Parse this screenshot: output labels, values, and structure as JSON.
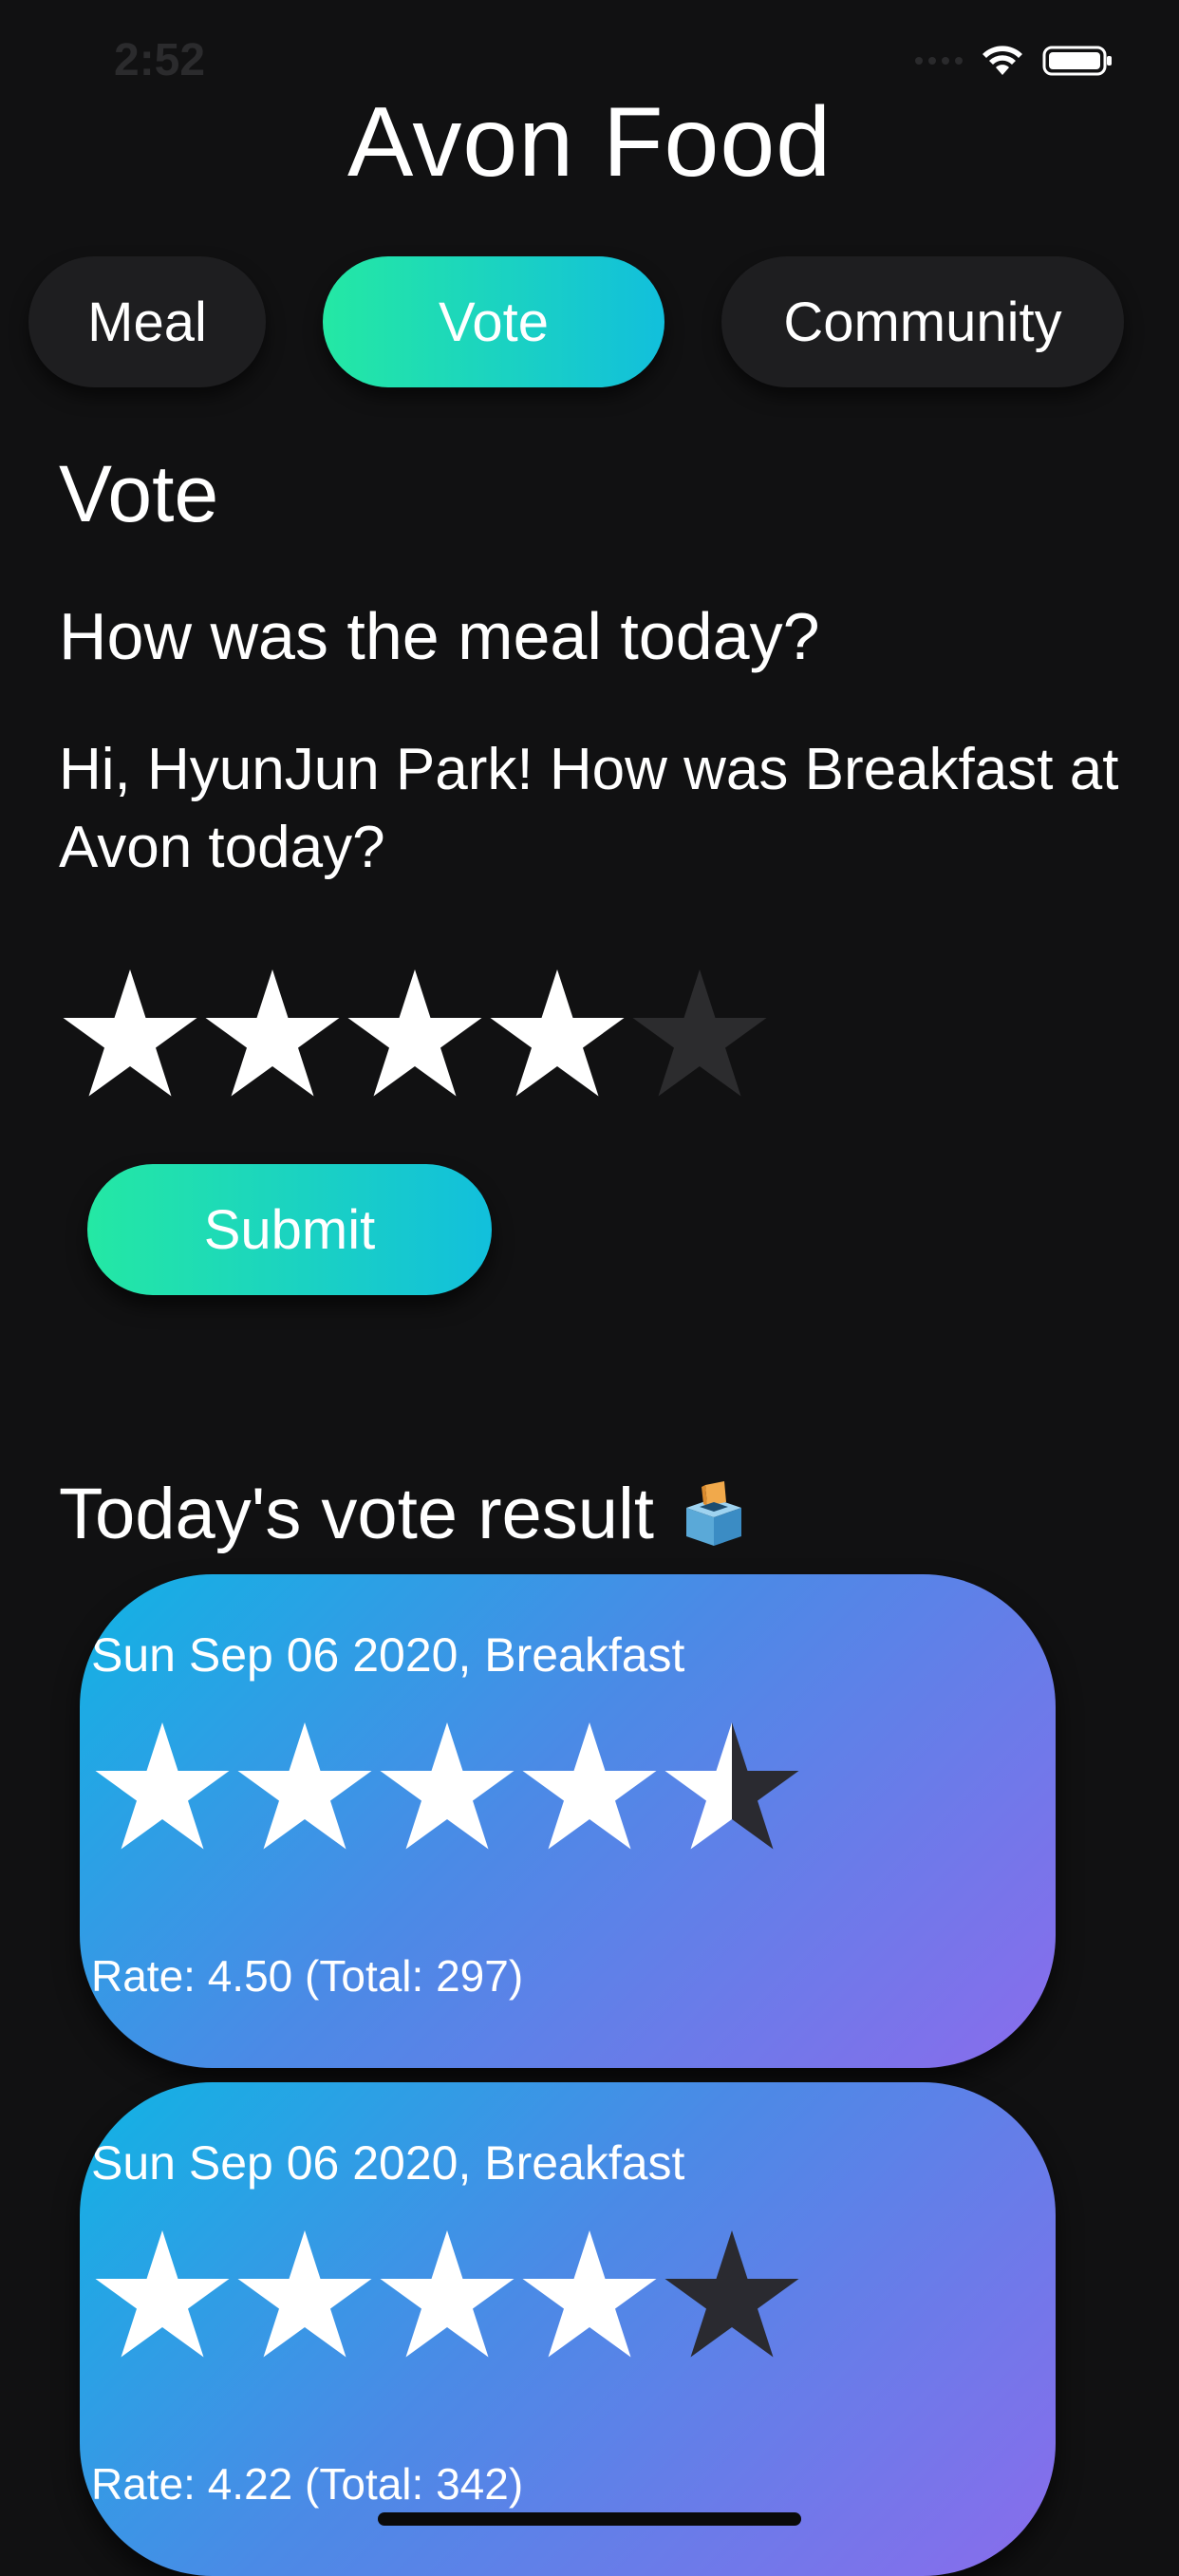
{
  "status_bar": {
    "time": "2:52",
    "icons": [
      "signal-icon",
      "wifi-icon",
      "battery-icon"
    ]
  },
  "app": {
    "title": "Avon Food"
  },
  "tabs": [
    {
      "label": "Meal",
      "active": false
    },
    {
      "label": "Vote",
      "active": true
    },
    {
      "label": "Community",
      "active": false
    }
  ],
  "vote": {
    "heading": "Vote",
    "question": "How was the meal today?",
    "greeting": "Hi, HyunJun Park! How was Breakfast at Avon today?",
    "rating_max": 5,
    "rating_value": 4,
    "submit_label": "Submit"
  },
  "results": {
    "heading": "Today's vote result",
    "heading_icon": "ballot-box-icon",
    "cards": [
      {
        "date_meal": "Sun Sep 06 2020, Breakfast",
        "rating": 4.5,
        "rate_text": "Rate: 4.50 (Total: 297)"
      },
      {
        "date_meal": "Sun Sep 06 2020, Breakfast",
        "rating": 4.22,
        "rate_text": "Rate: 4.22 (Total: 342)"
      }
    ]
  },
  "colors": {
    "background": "#111112",
    "accent_gradient_start": "#24e8a4",
    "accent_gradient_end": "#12bfdc",
    "card_gradient_start": "#11b3e4",
    "card_gradient_end": "#8a6cec",
    "star_filled": "#ffffff",
    "star_empty": "#2c2c2e",
    "star_empty_on_card": "#2a2a30"
  }
}
